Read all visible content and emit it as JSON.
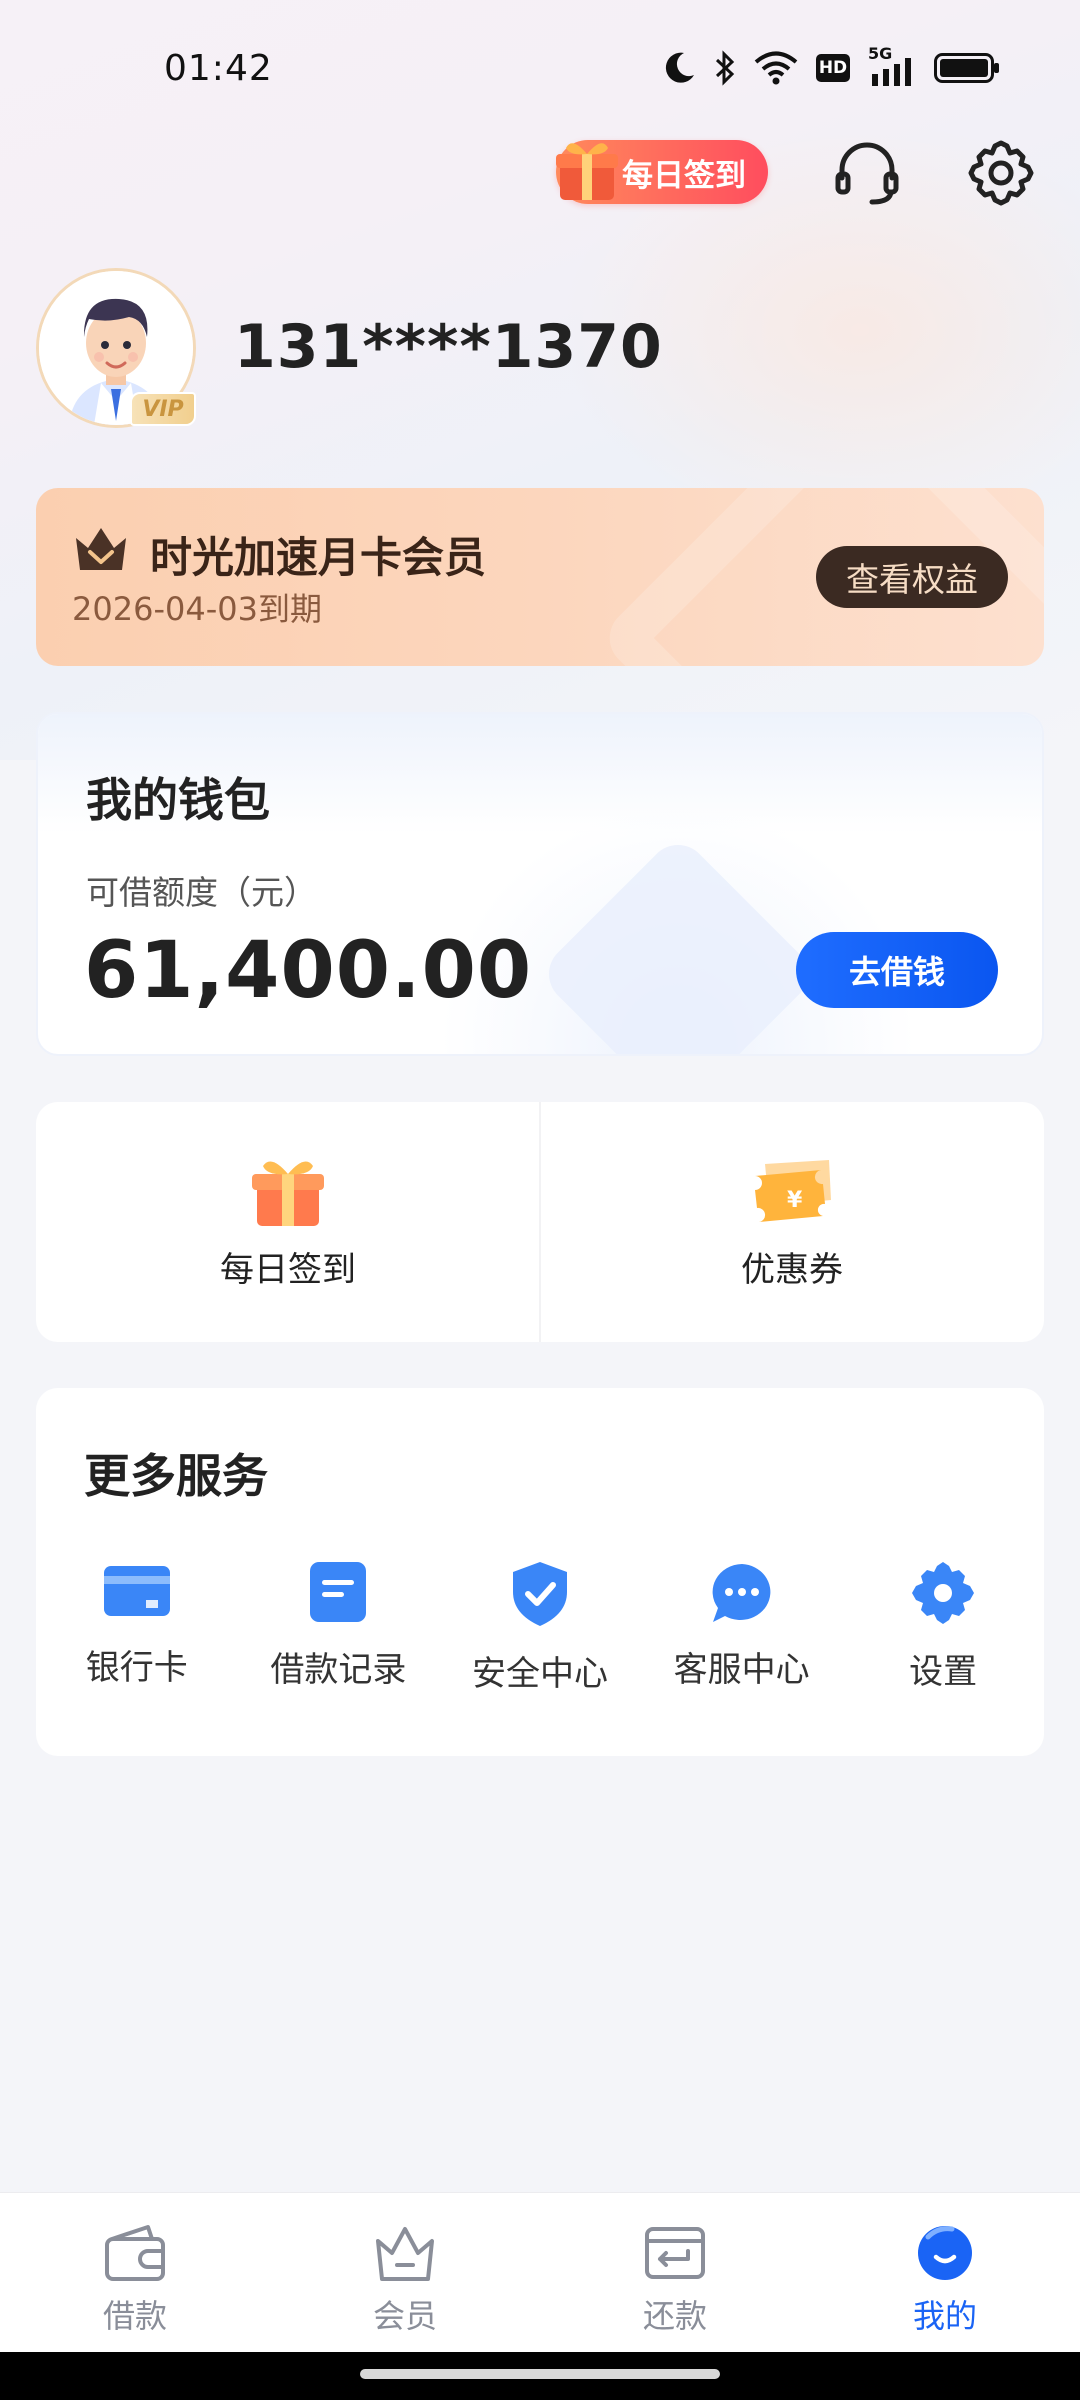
{
  "status_bar": {
    "time": "01:42",
    "network_label": "5G",
    "hd_label": "HD"
  },
  "header": {
    "checkin_label": "每日签到"
  },
  "profile": {
    "phone": "131****1370",
    "vip_label": "VIP"
  },
  "membership": {
    "title": "时光加速月卡会员",
    "expiry": "2026-04-03到期",
    "benefit_button": "查看权益"
  },
  "wallet": {
    "title": "我的钱包",
    "credit_label": "可借额度（元）",
    "credit_amount": "61,400.00",
    "borrow_button": "去借钱"
  },
  "quick_actions": [
    {
      "label": "每日签到",
      "icon": "gift-icon"
    },
    {
      "label": "优惠券",
      "icon": "coupon-icon"
    }
  ],
  "services": {
    "title": "更多服务",
    "items": [
      {
        "label": "银行卡",
        "icon": "bank-card-icon"
      },
      {
        "label": "借款记录",
        "icon": "document-icon"
      },
      {
        "label": "安全中心",
        "icon": "shield-check-icon"
      },
      {
        "label": "客服中心",
        "icon": "chat-bubble-icon"
      },
      {
        "label": "设置",
        "icon": "gear-icon"
      }
    ]
  },
  "bottom_nav": [
    {
      "label": "借款",
      "icon": "wallet-icon",
      "active": false
    },
    {
      "label": "会员",
      "icon": "crown-icon",
      "active": false
    },
    {
      "label": "还款",
      "icon": "repay-icon",
      "active": false
    },
    {
      "label": "我的",
      "icon": "profile-icon",
      "active": true
    }
  ],
  "colors": {
    "accent_blue": "#1a64f5",
    "member_card": "#fbcfb0",
    "checkin_gradient_start": "#ff8a5c",
    "checkin_gradient_end": "#ff4d5e"
  }
}
